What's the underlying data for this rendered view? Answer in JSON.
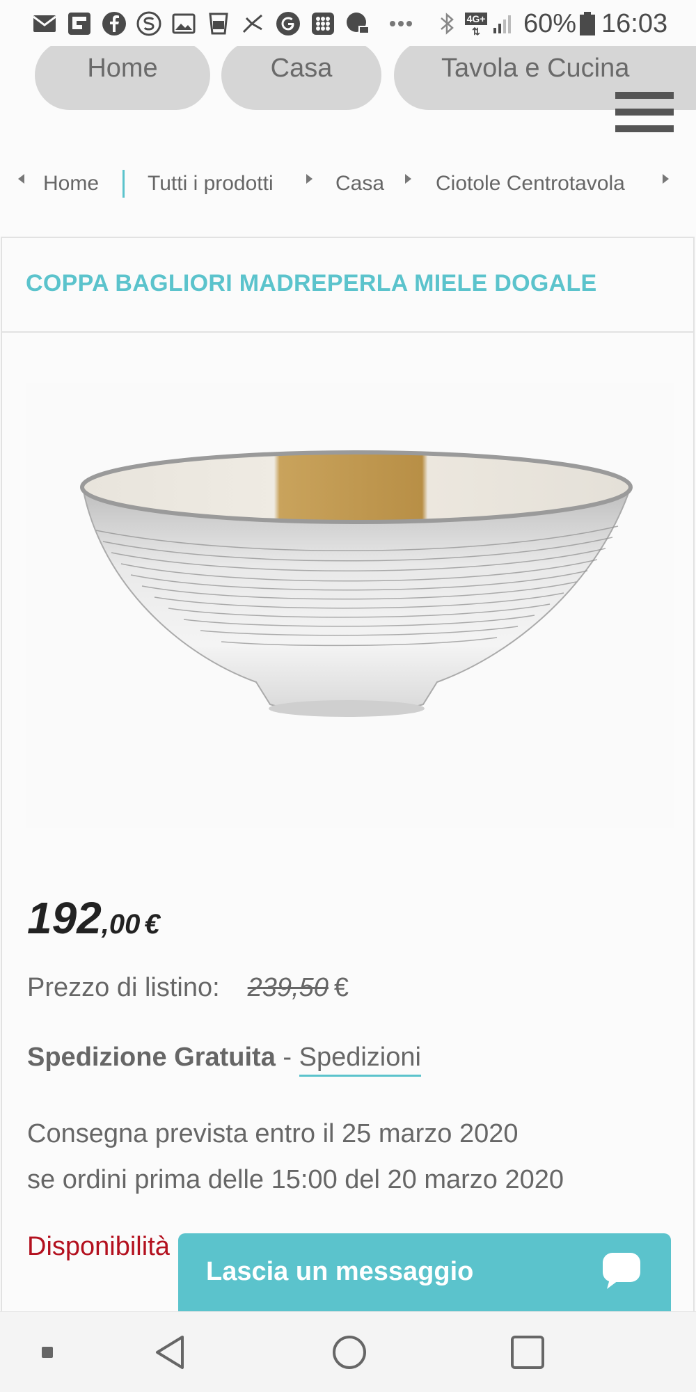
{
  "status_bar": {
    "icons": [
      "mail-icon",
      "flipboard-icon",
      "facebook-icon",
      "skype-icon",
      "gallery-icon",
      "cup-icon",
      "dancer-icon",
      "google-icon",
      "grid-app-icon",
      "chat-app-icon",
      "more-dots-icon",
      "bluetooth-icon",
      "network-4g-icon",
      "signal-icon",
      "battery-icon"
    ],
    "network": "4G+",
    "battery": "60%",
    "time": "16:03"
  },
  "nav": {
    "pills": [
      "Home",
      "Casa",
      "Tavola e Cucina"
    ],
    "menu_icon": "hamburger-menu-icon"
  },
  "breadcrumb": {
    "items": [
      "Home",
      "Tutti i prodotti",
      "Casa",
      "Ciotole Centrotavola"
    ]
  },
  "product": {
    "title": "COPPA BAGLIORI MADREPERLA MIELE DOGALE",
    "price_int": "192",
    "price_dec": ",00",
    "price_currency": "€",
    "list_label": "Prezzo di listino:",
    "list_price": "239,50",
    "list_currency": "€",
    "shipping_bold": "Spedizione Gratuita",
    "shipping_sep": " - ",
    "shipping_link": "Spedizioni",
    "delivery_line1": "Consegna prevista entro il 25 marzo 2020",
    "delivery_line2": "se ordini prima delle 15:00 del 20 marzo 2020",
    "availability": "Disponibilità"
  },
  "chat": {
    "label": "Lascia un messaggio",
    "icon": "chat-bubble-icon"
  },
  "system_nav": {
    "icons": [
      "recent-dot-icon",
      "back-icon",
      "home-circle-icon",
      "overview-square-icon"
    ]
  },
  "colors": {
    "accent": "#5bc3cc",
    "pill": "#d6d6d6",
    "availability": "#b3101e",
    "price": "#222222"
  }
}
